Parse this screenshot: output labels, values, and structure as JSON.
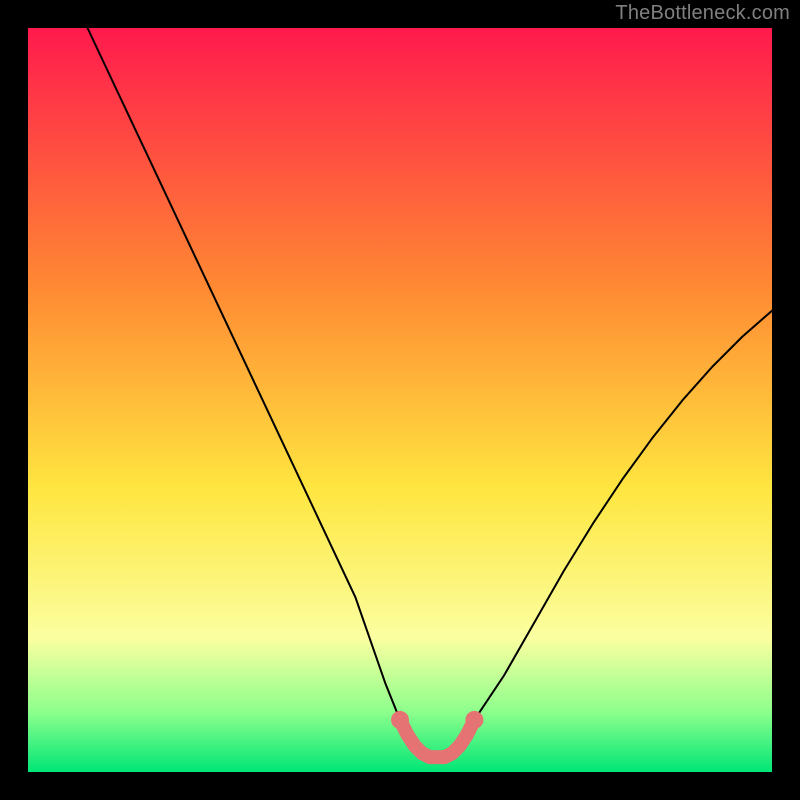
{
  "watermark": "TheBottleneck.com",
  "colors": {
    "black": "#000000",
    "curve_stroke": "#000000",
    "highlight": "#e57373",
    "grad_top": "#ff1a4d",
    "grad_mid_orange": "#ff8a33",
    "grad_yellow": "#ffe640",
    "grad_pale_yellow": "#fbffa0",
    "grad_green_light": "#8cff8c",
    "grad_green": "#00e676"
  },
  "chart_data": {
    "type": "line",
    "title": "",
    "xlabel": "",
    "ylabel": "",
    "xlim": [
      0,
      100
    ],
    "ylim": [
      0,
      100
    ],
    "series": [
      {
        "name": "bottleneck-curve",
        "x": [
          8,
          12,
          16,
          20,
          24,
          28,
          32,
          36,
          40,
          44,
          48,
          50,
          51,
          52,
          53,
          54,
          55,
          56,
          57,
          58,
          59,
          60,
          64,
          68,
          72,
          76,
          80,
          84,
          88,
          92,
          96,
          100
        ],
        "y": [
          100,
          91.5,
          83,
          74.5,
          66,
          57.5,
          49,
          40.5,
          32,
          23.5,
          12,
          7,
          5,
          3.5,
          2.5,
          2,
          2,
          2,
          2.5,
          3.5,
          5,
          7,
          13,
          20,
          27,
          33.5,
          39.5,
          45,
          50,
          54.5,
          58.5,
          62
        ]
      }
    ],
    "highlight_range_x": [
      50,
      60
    ],
    "annotations": []
  }
}
